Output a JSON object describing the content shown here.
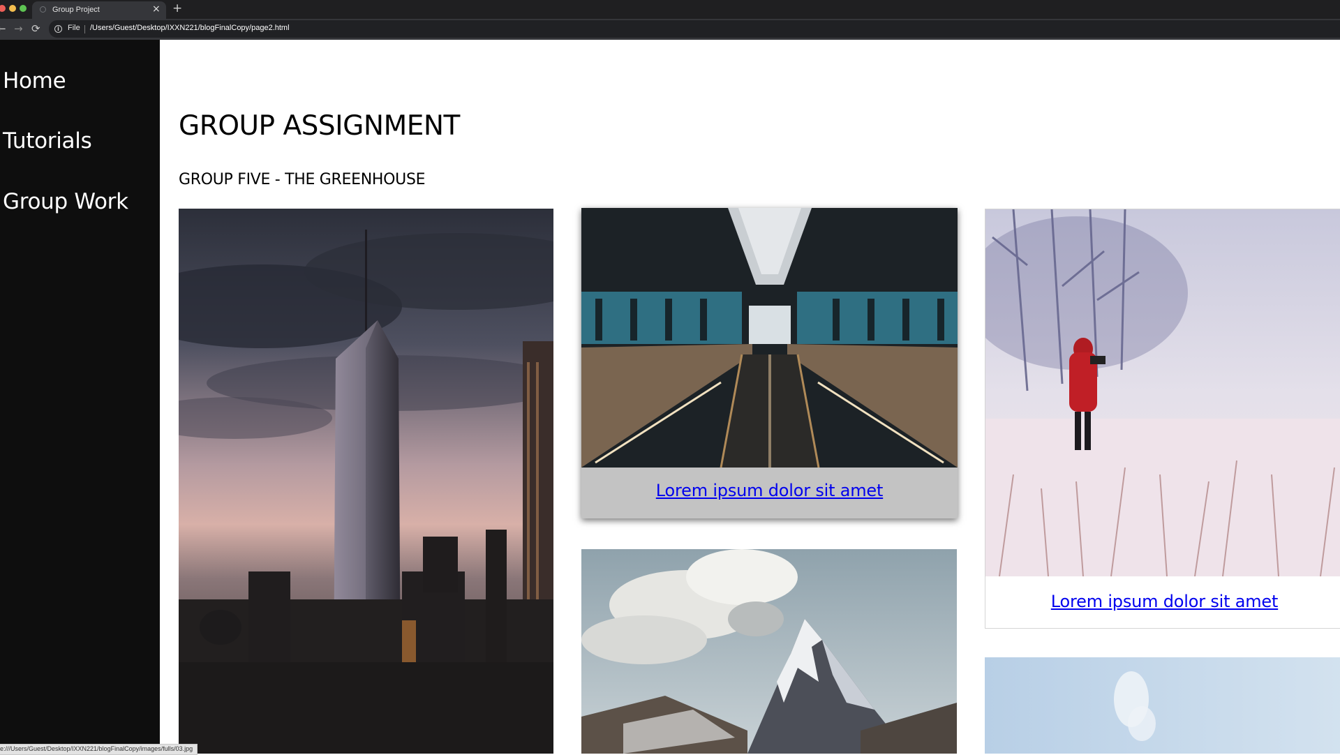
{
  "browser": {
    "tab_title": "Group Project",
    "tab_close": "×",
    "new_tab": "+",
    "back": "←",
    "forward": "→",
    "reload": "⟳",
    "scheme_label": "File",
    "url": "/Users/Guest/Desktop/IXXN221/blogFinalCopy/page2.html",
    "status_url": "e:///Users/Guest/Desktop/IXXN221/blogFinalCopy/images/fulls/03.jpg"
  },
  "sidebar": {
    "items": [
      {
        "label": "Home"
      },
      {
        "label": "Tutorials"
      },
      {
        "label": "Group Work"
      }
    ]
  },
  "main": {
    "title": "GROUP ASSIGNMENT",
    "subtitle": "GROUP FIVE - THE GREENHOUSE",
    "cards": [
      {
        "caption": ""
      },
      {
        "caption": "Lorem ipsum dolor sit amet"
      },
      {
        "caption": "Lorem ipsum dolor sit amet"
      },
      {
        "caption": ""
      },
      {
        "caption": ""
      }
    ]
  },
  "colors": {
    "sidebar_bg": "#0e0e0e",
    "link": "#0000ee",
    "caption_bg": "#c3c3c3"
  }
}
